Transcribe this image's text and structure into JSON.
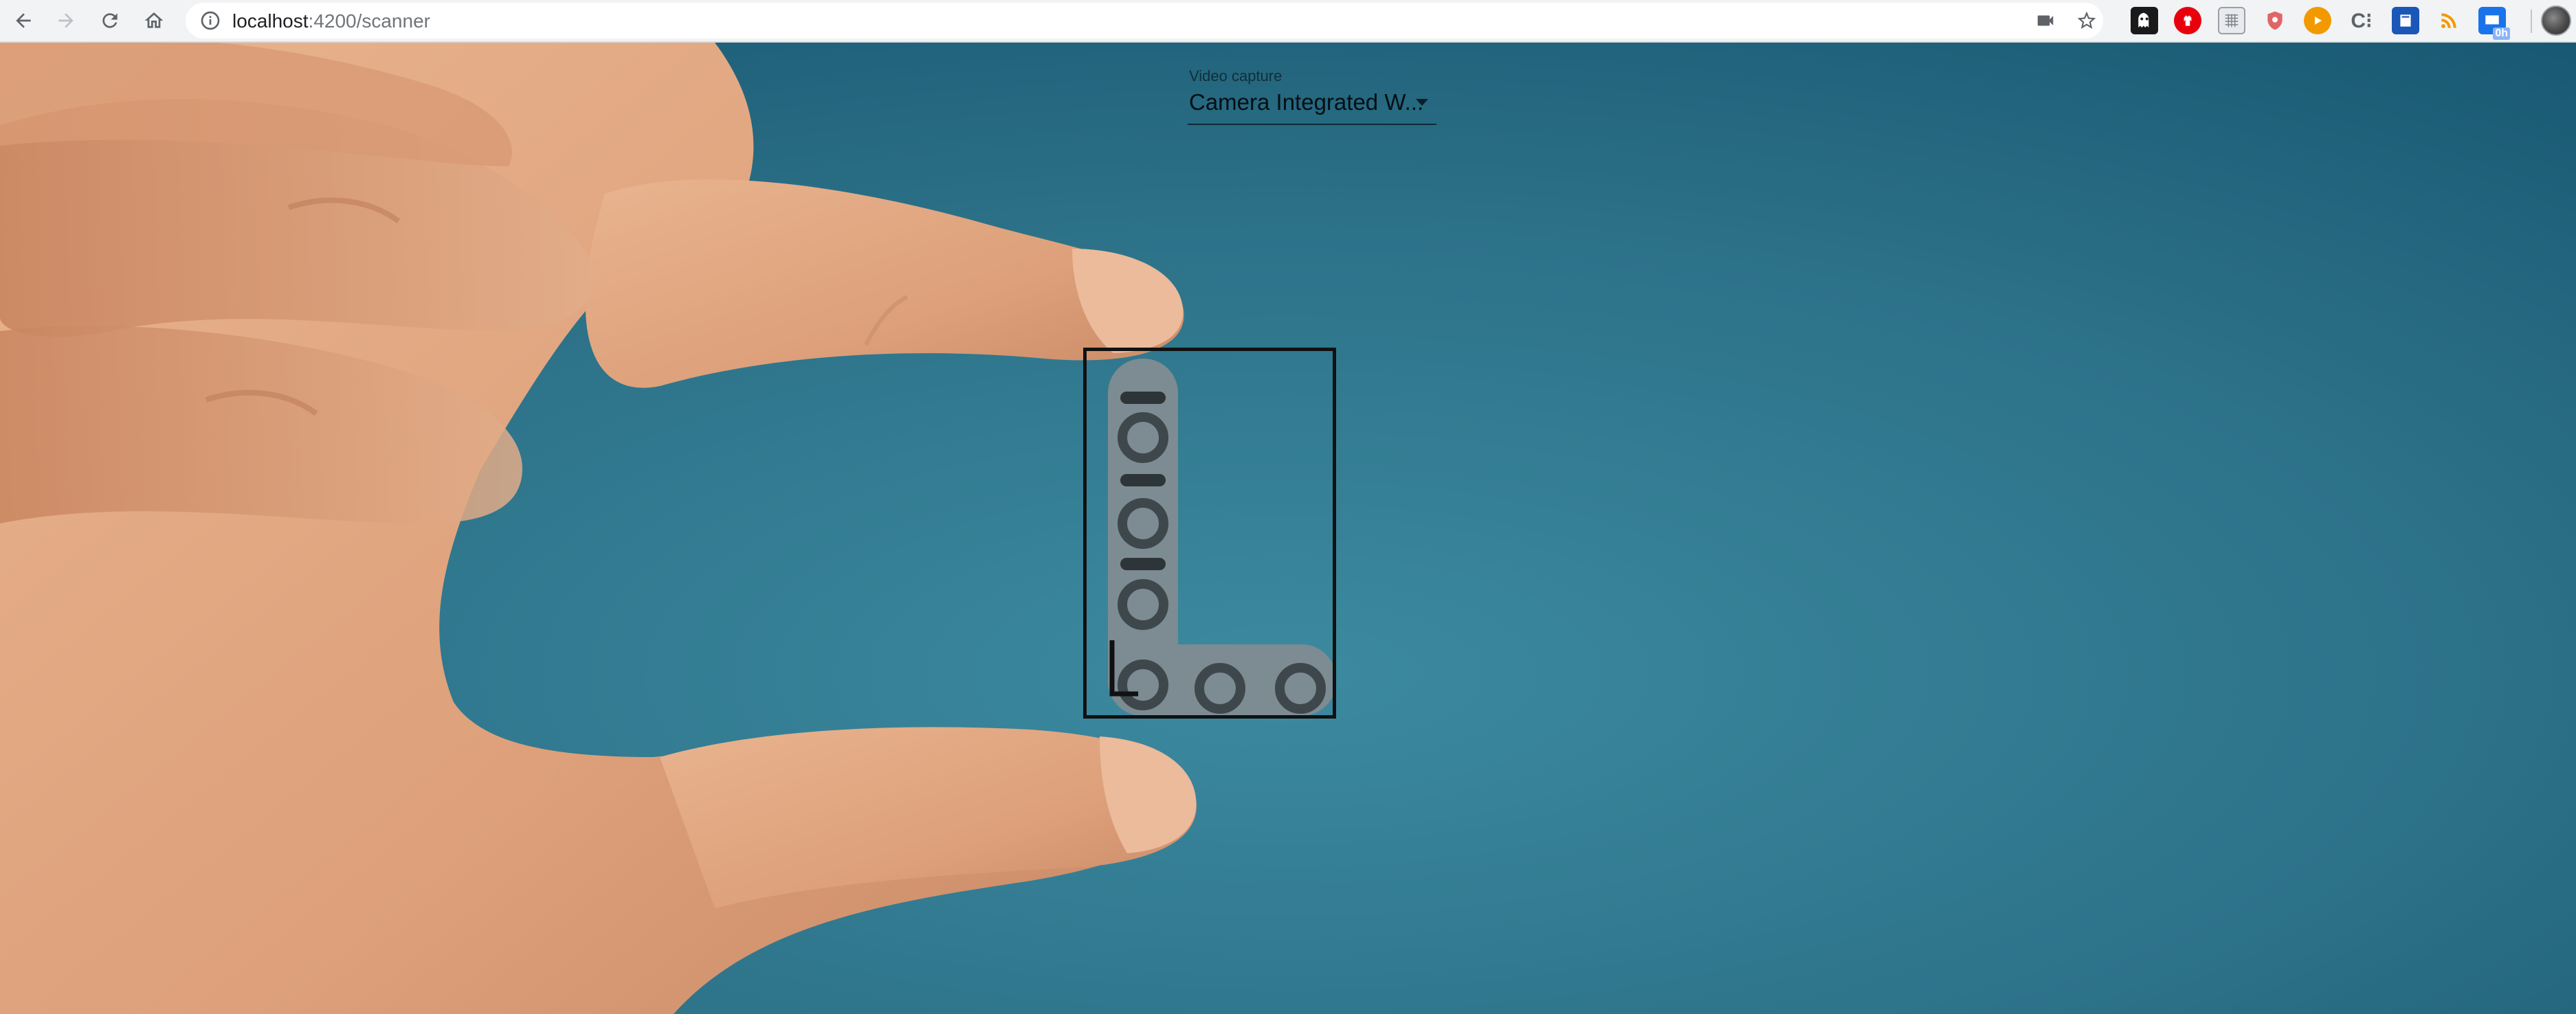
{
  "browser": {
    "url_host": "localhost",
    "url_path": ":4200/scanner",
    "nav": {
      "back": "back-arrow-icon",
      "forward": "forward-arrow-icon",
      "reload": "reload-icon",
      "home": "home-icon"
    },
    "extensions": [
      {
        "name": "ghostery-icon",
        "color": "#1a1a1a"
      },
      {
        "name": "adblock-icon",
        "color": "#e8000d"
      },
      {
        "name": "grid-extension-icon",
        "color": "#9aa0a6"
      },
      {
        "name": "shield-extension-icon",
        "color": "#e06666"
      },
      {
        "name": "play-extension-icon",
        "color": "#f29900"
      },
      {
        "name": "text-extension-icon",
        "color": "#5f6368"
      },
      {
        "name": "book-extension-icon",
        "color": "#1a57b8"
      },
      {
        "name": "rss-icon",
        "color": "#f29900"
      },
      {
        "name": "badge-extension-icon",
        "color": "#1a73e8"
      }
    ],
    "badge_text": "0h"
  },
  "scanner": {
    "video_capture_label": "Video capture",
    "video_capture_value": "Camera Integrated W..."
  },
  "colors": {
    "background": "#2a6f86",
    "detection_box": "#111111"
  }
}
